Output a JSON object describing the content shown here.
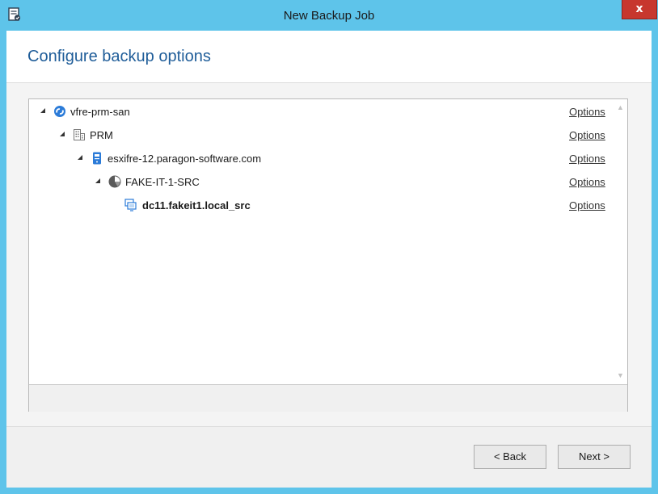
{
  "window": {
    "title": "New Backup Job",
    "close_label": "x"
  },
  "header": {
    "heading": "Configure backup options"
  },
  "tree": {
    "nodes": [
      {
        "label": "vfre-prm-san",
        "icon": "vcenter-icon",
        "options_label": "Options",
        "bold": false
      },
      {
        "label": "PRM",
        "icon": "datacenter-icon",
        "options_label": "Options",
        "bold": false
      },
      {
        "label": "esxifre-12.paragon-software.com",
        "icon": "host-icon",
        "options_label": "Options",
        "bold": false
      },
      {
        "label": "FAKE-IT-1-SRC",
        "icon": "resource-pool-icon",
        "options_label": "Options",
        "bold": false
      },
      {
        "label": "dc11.fakeit1.local_src",
        "icon": "vm-icon",
        "options_label": "Options",
        "bold": true
      }
    ]
  },
  "footer": {
    "back_label": "< Back",
    "next_label": "Next >"
  },
  "colors": {
    "frame": "#5ec4ea",
    "heading": "#1f5d99",
    "close": "#c7372e"
  }
}
